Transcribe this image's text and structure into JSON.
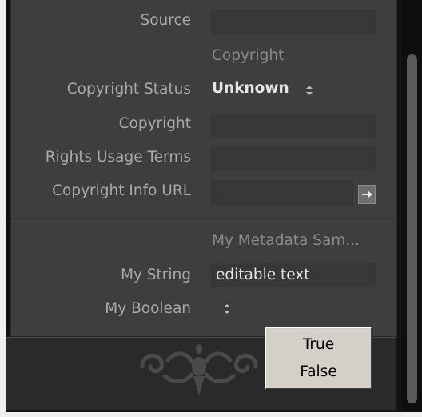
{
  "metadata_panel": {
    "source": {
      "label": "Source",
      "value": ""
    },
    "copyright_section": {
      "title": "Copyright"
    },
    "copyright_status": {
      "label": "Copyright Status",
      "value": "Unknown"
    },
    "copyright": {
      "label": "Copyright",
      "value": ""
    },
    "rights_usage_terms": {
      "label": "Rights Usage Terms",
      "value": ""
    },
    "copyright_info_url": {
      "label": "Copyright Info URL",
      "value": ""
    },
    "custom_section": {
      "title": "My Metadata Sam..."
    },
    "my_string": {
      "label": "My String",
      "value": "editable text"
    },
    "my_boolean": {
      "label": "My Boolean",
      "value": ""
    }
  },
  "boolean_menu": {
    "options": [
      "True",
      "False"
    ]
  },
  "colors": {
    "panel_bg": "#3e3e3e",
    "label_text": "#a9a9a9",
    "value_text": "#e6e6e6",
    "menu_bg": "#d4d0c8"
  },
  "icons": {
    "stepper": "updown-stepper-icon",
    "url_go": "arrow-right-icon",
    "ornament": "ornament-flourish-icon"
  }
}
